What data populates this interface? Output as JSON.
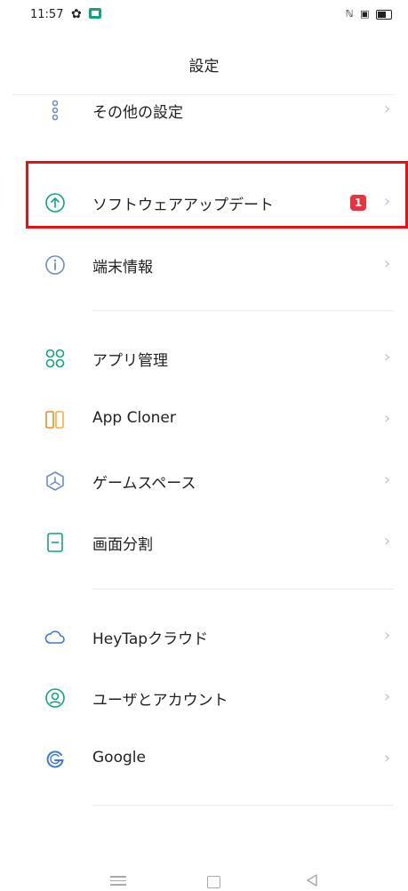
{
  "status_bar": {
    "time": "11:57"
  },
  "header": {
    "title": "設定"
  },
  "items": [
    {
      "label": "その他の設定",
      "icon": "more-dots-icon"
    },
    {
      "label": "ソフトウェアアップデート",
      "icon": "update-arrow-icon",
      "badge": "1"
    },
    {
      "label": "端末情報",
      "icon": "info-icon"
    },
    {
      "label": "アプリ管理",
      "icon": "app-grid-icon"
    },
    {
      "label": "App Cloner",
      "icon": "app-cloner-icon"
    },
    {
      "label": "ゲームスペース",
      "icon": "game-space-icon"
    },
    {
      "label": "画面分割",
      "icon": "split-screen-icon"
    },
    {
      "label": "HeyTapクラウド",
      "icon": "cloud-icon"
    },
    {
      "label": "ユーザとアカウント",
      "icon": "user-account-icon"
    },
    {
      "label": "Google",
      "icon": "google-icon"
    }
  ],
  "chevron": "›",
  "colors": {
    "accent_green": "#12a37f",
    "badge_red": "#e8343f",
    "highlight_red": "#e81010"
  }
}
